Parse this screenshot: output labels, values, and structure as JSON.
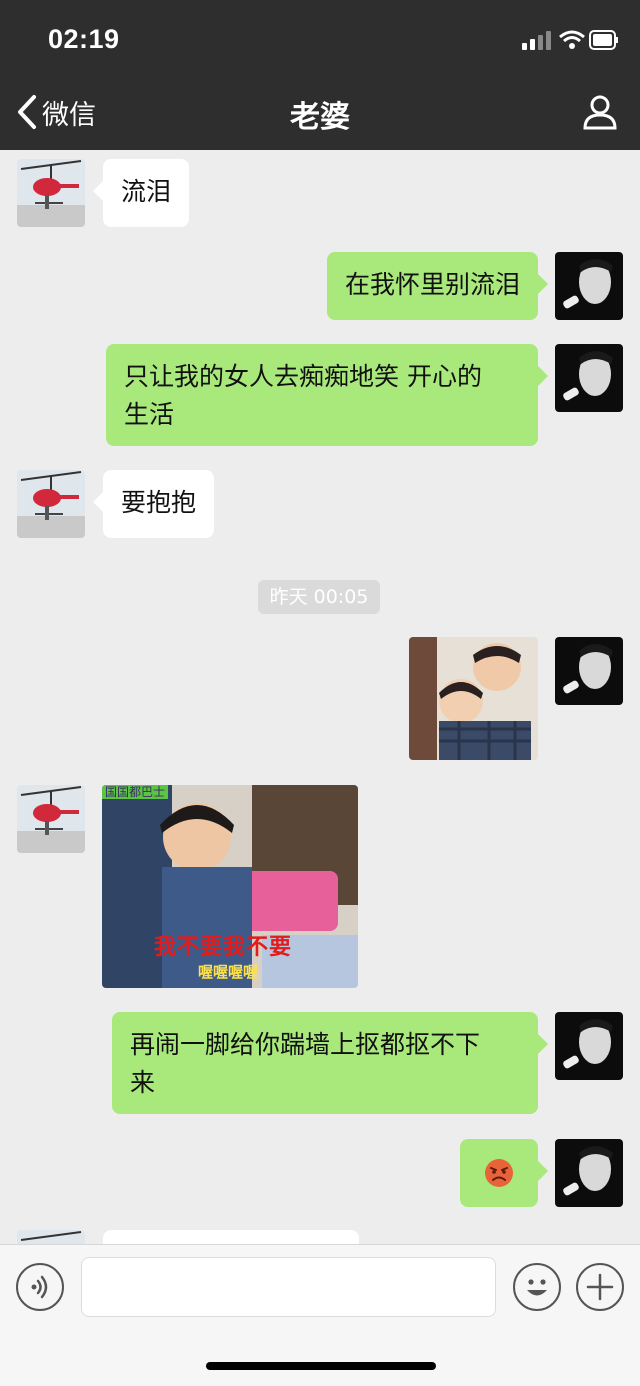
{
  "status_bar": {
    "time": "02:19"
  },
  "nav": {
    "back_label": "微信",
    "title": "老婆"
  },
  "messages": {
    "m1": "流泪",
    "m2": "在我怀里别流泪",
    "m3_line1": "只让我的女人去痴痴地笑 开心的",
    "m3_line2": "生活",
    "m4": "要抱抱",
    "timestamp": "昨天 00:05",
    "sticker_caption": "我不要我不要",
    "sticker_sub": "喔喔喔喔",
    "sticker_tag": "国国都巴士",
    "m6_line1": "再闹一脚给你踹墙上抠都抠不下",
    "m6_line2": "来",
    "m7_emoji": "😡"
  },
  "input": {
    "value": ""
  },
  "colors": {
    "header_bg": "#2e2e2e",
    "chat_bg": "#ededed",
    "bubble_out": "#a9e87a",
    "bubble_in": "#ffffff"
  },
  "icons": {
    "back": "chevron-left-icon",
    "profile": "person-icon",
    "voice": "voice-icon",
    "emoji": "smiley-icon",
    "more": "plus-icon"
  }
}
